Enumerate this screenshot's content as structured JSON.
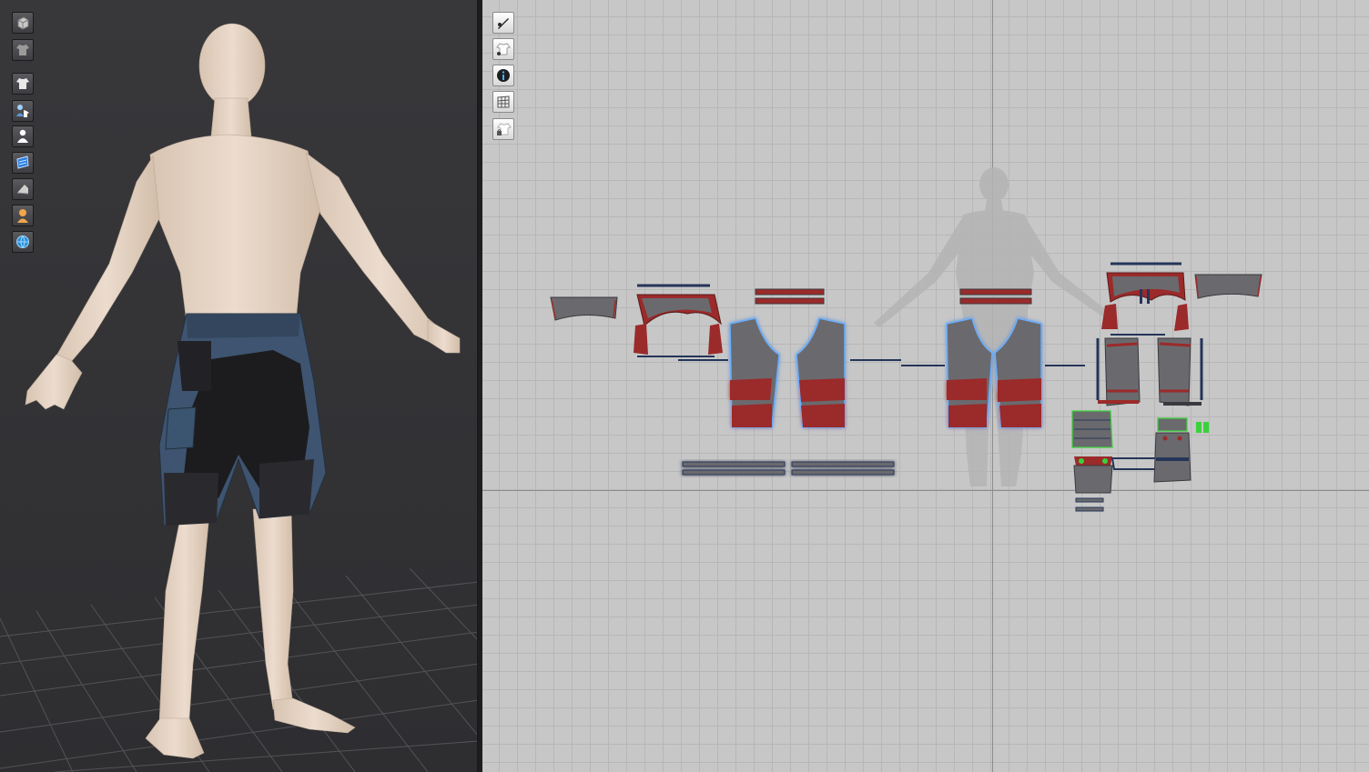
{
  "viewport_3d": {
    "background": "#3b3b3e",
    "toolbar": [
      {
        "icon": "avatar-cube-icon"
      },
      {
        "icon": "garment-shirt-gray-icon"
      },
      {
        "icon": "garment-shirt-icon"
      },
      {
        "icon": "avatar-garment-icon"
      },
      {
        "icon": "avatar-silhouette-icon"
      },
      {
        "icon": "fabric-texture-icon"
      },
      {
        "icon": "fold-icon"
      },
      {
        "icon": "avatar-bust-icon"
      },
      {
        "icon": "globe-icon"
      }
    ]
  },
  "viewport_2d": {
    "background": "#c7c7c7",
    "toolbar": [
      {
        "icon": "pen-tool-icon"
      },
      {
        "icon": "show-garment-icon"
      },
      {
        "icon": "info-icon"
      },
      {
        "icon": "grid-pattern-icon"
      },
      {
        "icon": "locked-garment-icon"
      }
    ]
  },
  "colors": {
    "pattern_fill": "#6a6a6e",
    "seam_red": "#9b2a2a",
    "selection_glow": "#6aaeff",
    "sewing_line": "#25355a",
    "skin": "#e7d6c7",
    "shorts_blue": "#3e5470",
    "shorts_black": "#1c1c1e"
  }
}
